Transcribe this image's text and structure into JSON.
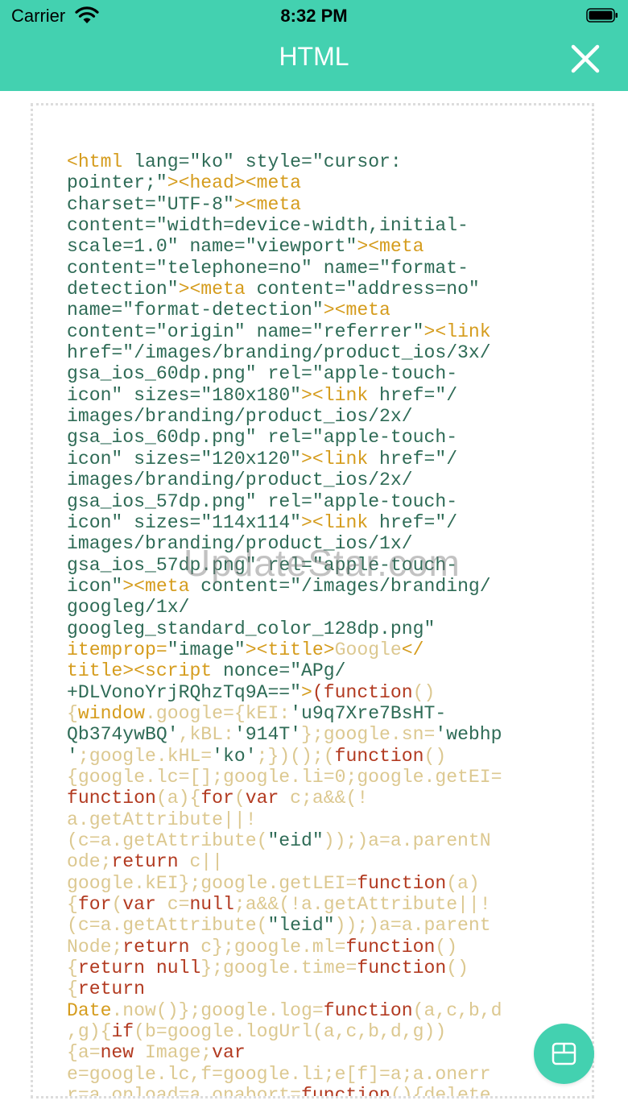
{
  "status_bar": {
    "carrier": "Carrier",
    "time": "8:32 PM"
  },
  "nav": {
    "title": "HTML"
  },
  "watermark": "UpdateStar.com",
  "colors": {
    "accent": "#43d1b0",
    "tag": "#d59c1d",
    "attribute": "#2e6b56",
    "keyword": "#b23a20",
    "plain_code": "#dcc890"
  },
  "icons": {
    "wifi": "wifi-icon",
    "battery": "battery-icon",
    "close": "close-icon",
    "fab": "box-icon"
  },
  "code_lines": [
    [
      [
        "tag",
        "<html"
      ],
      [
        "attr",
        " lang="
      ],
      [
        "str",
        "\"ko\""
      ],
      [
        "attr",
        " style="
      ],
      [
        "str",
        "\"cursor:"
      ]
    ],
    [
      [
        "str",
        "pointer;\""
      ],
      [
        "tag",
        "><head><meta"
      ]
    ],
    [
      [
        "attr",
        "charset="
      ],
      [
        "str",
        "\"UTF-8\""
      ],
      [
        "tag",
        "><meta"
      ]
    ],
    [
      [
        "attr",
        "content="
      ],
      [
        "str",
        "\"width=device-width,initial-"
      ]
    ],
    [
      [
        "str",
        "scale=1.0\""
      ],
      [
        "attr",
        " name="
      ],
      [
        "str",
        "\"viewport\""
      ],
      [
        "tag",
        "><meta"
      ]
    ],
    [
      [
        "attr",
        "content="
      ],
      [
        "str",
        "\"telephone=no\""
      ],
      [
        "attr",
        " name="
      ],
      [
        "str",
        "\"format-"
      ]
    ],
    [
      [
        "str",
        "detection\""
      ],
      [
        "tag",
        "><meta"
      ],
      [
        "attr",
        " content="
      ],
      [
        "str",
        "\"address=no\""
      ]
    ],
    [
      [
        "attr",
        "name="
      ],
      [
        "str",
        "\"format-detection\""
      ],
      [
        "tag",
        "><meta"
      ]
    ],
    [
      [
        "attr",
        "content="
      ],
      [
        "str",
        "\"origin\""
      ],
      [
        "attr",
        " name="
      ],
      [
        "str",
        "\"referrer\""
      ],
      [
        "tag",
        "><link"
      ]
    ],
    [
      [
        "attr",
        "href="
      ],
      [
        "str",
        "\"/images/branding/product_ios/3x/"
      ]
    ],
    [
      [
        "str",
        "gsa_ios_60dp.png\""
      ],
      [
        "attr",
        " rel="
      ],
      [
        "str",
        "\"apple-touch-"
      ]
    ],
    [
      [
        "str",
        "icon\""
      ],
      [
        "attr",
        " sizes="
      ],
      [
        "str",
        "\"180x180\""
      ],
      [
        "tag",
        "><link"
      ],
      [
        "attr",
        " href="
      ],
      [
        "str",
        "\"/"
      ]
    ],
    [
      [
        "str",
        "images/branding/product_ios/2x/"
      ]
    ],
    [
      [
        "str",
        "gsa_ios_60dp.png\""
      ],
      [
        "attr",
        " rel="
      ],
      [
        "str",
        "\"apple-touch-"
      ]
    ],
    [
      [
        "str",
        "icon\""
      ],
      [
        "attr",
        " sizes="
      ],
      [
        "str",
        "\"120x120\""
      ],
      [
        "tag",
        "><link"
      ],
      [
        "attr",
        " href="
      ],
      [
        "str",
        "\"/"
      ]
    ],
    [
      [
        "str",
        "images/branding/product_ios/2x/"
      ]
    ],
    [
      [
        "str",
        "gsa_ios_57dp.png\""
      ],
      [
        "attr",
        " rel="
      ],
      [
        "str",
        "\"apple-touch-"
      ]
    ],
    [
      [
        "str",
        "icon\""
      ],
      [
        "attr",
        " sizes="
      ],
      [
        "str",
        "\"114x114\""
      ],
      [
        "tag",
        "><link"
      ],
      [
        "attr",
        " href="
      ],
      [
        "str",
        "\"/"
      ]
    ],
    [
      [
        "str",
        "images/branding/product_ios/1x/"
      ]
    ],
    [
      [
        "str",
        "gsa_ios_57dp.png\""
      ],
      [
        "attr",
        " rel="
      ],
      [
        "str",
        "\"apple-touch-"
      ]
    ],
    [
      [
        "str",
        "icon\""
      ],
      [
        "tag",
        "><meta"
      ],
      [
        "attr",
        " content="
      ],
      [
        "str",
        "\"/images/branding/"
      ]
    ],
    [
      [
        "str",
        "googleg/1x/"
      ]
    ],
    [
      [
        "str",
        "googleg_standard_color_128dp.png\""
      ]
    ],
    [
      [
        "tag",
        "itemprop="
      ],
      [
        "str",
        "\"image\""
      ],
      [
        "tag",
        "><title>"
      ],
      [
        "tx",
        "Google"
      ],
      [
        "tag",
        "</"
      ]
    ],
    [
      [
        "tag",
        "title><script"
      ],
      [
        "attr",
        " nonce="
      ],
      [
        "str",
        "\"APg/"
      ]
    ],
    [
      [
        "str",
        "+DLVonoYrjRQhzTq9A==\""
      ],
      [
        "tag",
        ">"
      ],
      [
        "kw",
        "(function"
      ],
      [
        "tx",
        "()"
      ]
    ],
    [
      [
        "tx",
        "{"
      ],
      [
        "op",
        "window"
      ],
      [
        "tx",
        ".google={kEI:"
      ],
      [
        "str",
        "'u9q7Xre7BsHT-"
      ]
    ],
    [
      [
        "str",
        "Qb374ywBQ'"
      ],
      [
        "tx",
        ",kBL:"
      ],
      [
        "str",
        "'914T'"
      ],
      [
        "tx",
        "};google.sn="
      ],
      [
        "str",
        "'webhp"
      ]
    ],
    [
      [
        "str",
        "'"
      ],
      [
        "tx",
        ";google.kHL="
      ],
      [
        "str",
        "'ko'"
      ],
      [
        "tx",
        ";})();("
      ],
      [
        "kw",
        "function"
      ],
      [
        "tx",
        "()"
      ]
    ],
    [
      [
        "tx",
        "{google.lc=[];google.li=0;google.getEI="
      ]
    ],
    [
      [
        "kw",
        "function"
      ],
      [
        "tx",
        "(a){"
      ],
      [
        "kw",
        "for"
      ],
      [
        "tx",
        "("
      ],
      [
        "kw",
        "var"
      ],
      [
        "tx",
        " c;a&&(!"
      ]
    ],
    [
      [
        "tx",
        "a.getAttribute||!"
      ]
    ],
    [
      [
        "tx",
        "(c=a.getAttribute("
      ],
      [
        "str",
        "\"eid\""
      ],
      [
        "tx",
        "));)a=a.parentN"
      ]
    ],
    [
      [
        "tx",
        "ode;"
      ],
      [
        "kw",
        "return"
      ],
      [
        "tx",
        " c||"
      ]
    ],
    [
      [
        "tx",
        "google.kEI};google.getLEI="
      ],
      [
        "kw",
        "function"
      ],
      [
        "tx",
        "(a)"
      ]
    ],
    [
      [
        "tx",
        "{"
      ],
      [
        "kw",
        "for"
      ],
      [
        "tx",
        "("
      ],
      [
        "kw",
        "var"
      ],
      [
        "tx",
        " c="
      ],
      [
        "kw",
        "null"
      ],
      [
        "tx",
        ";a&&(!a.getAttribute||!"
      ]
    ],
    [
      [
        "tx",
        "(c=a.getAttribute("
      ],
      [
        "str",
        "\"leid\""
      ],
      [
        "tx",
        "));)a=a.parent"
      ]
    ],
    [
      [
        "tx",
        "Node;"
      ],
      [
        "kw",
        "return"
      ],
      [
        "tx",
        " c};google.ml="
      ],
      [
        "kw",
        "function"
      ],
      [
        "tx",
        "()"
      ]
    ],
    [
      [
        "tx",
        "{"
      ],
      [
        "kw",
        "return null"
      ],
      [
        "tx",
        "};google.time="
      ],
      [
        "kw",
        "function"
      ],
      [
        "tx",
        "()"
      ]
    ],
    [
      [
        "tx",
        "{"
      ],
      [
        "kw",
        "return"
      ]
    ],
    [
      [
        "op",
        "Date"
      ],
      [
        "tx",
        ".now()};google.log="
      ],
      [
        "kw",
        "function"
      ],
      [
        "tx",
        "(a,c,b,d"
      ]
    ],
    [
      [
        "tx",
        ",g){"
      ],
      [
        "kw",
        "if"
      ],
      [
        "tx",
        "(b=google.logUrl(a,c,b,d,g))"
      ]
    ],
    [
      [
        "tx",
        "{a="
      ],
      [
        "kw",
        "new"
      ],
      [
        "tx",
        " Image;"
      ],
      [
        "kw",
        "var"
      ]
    ],
    [
      [
        "tx",
        "e=google.lc,f=google.li;e[f]=a;a.onerr"
      ]
    ],
    [
      [
        "tx",
        "r=a.onload=a.onabort="
      ],
      [
        "kw",
        "function"
      ],
      [
        "tx",
        "(){delete"
      ]
    ]
  ]
}
